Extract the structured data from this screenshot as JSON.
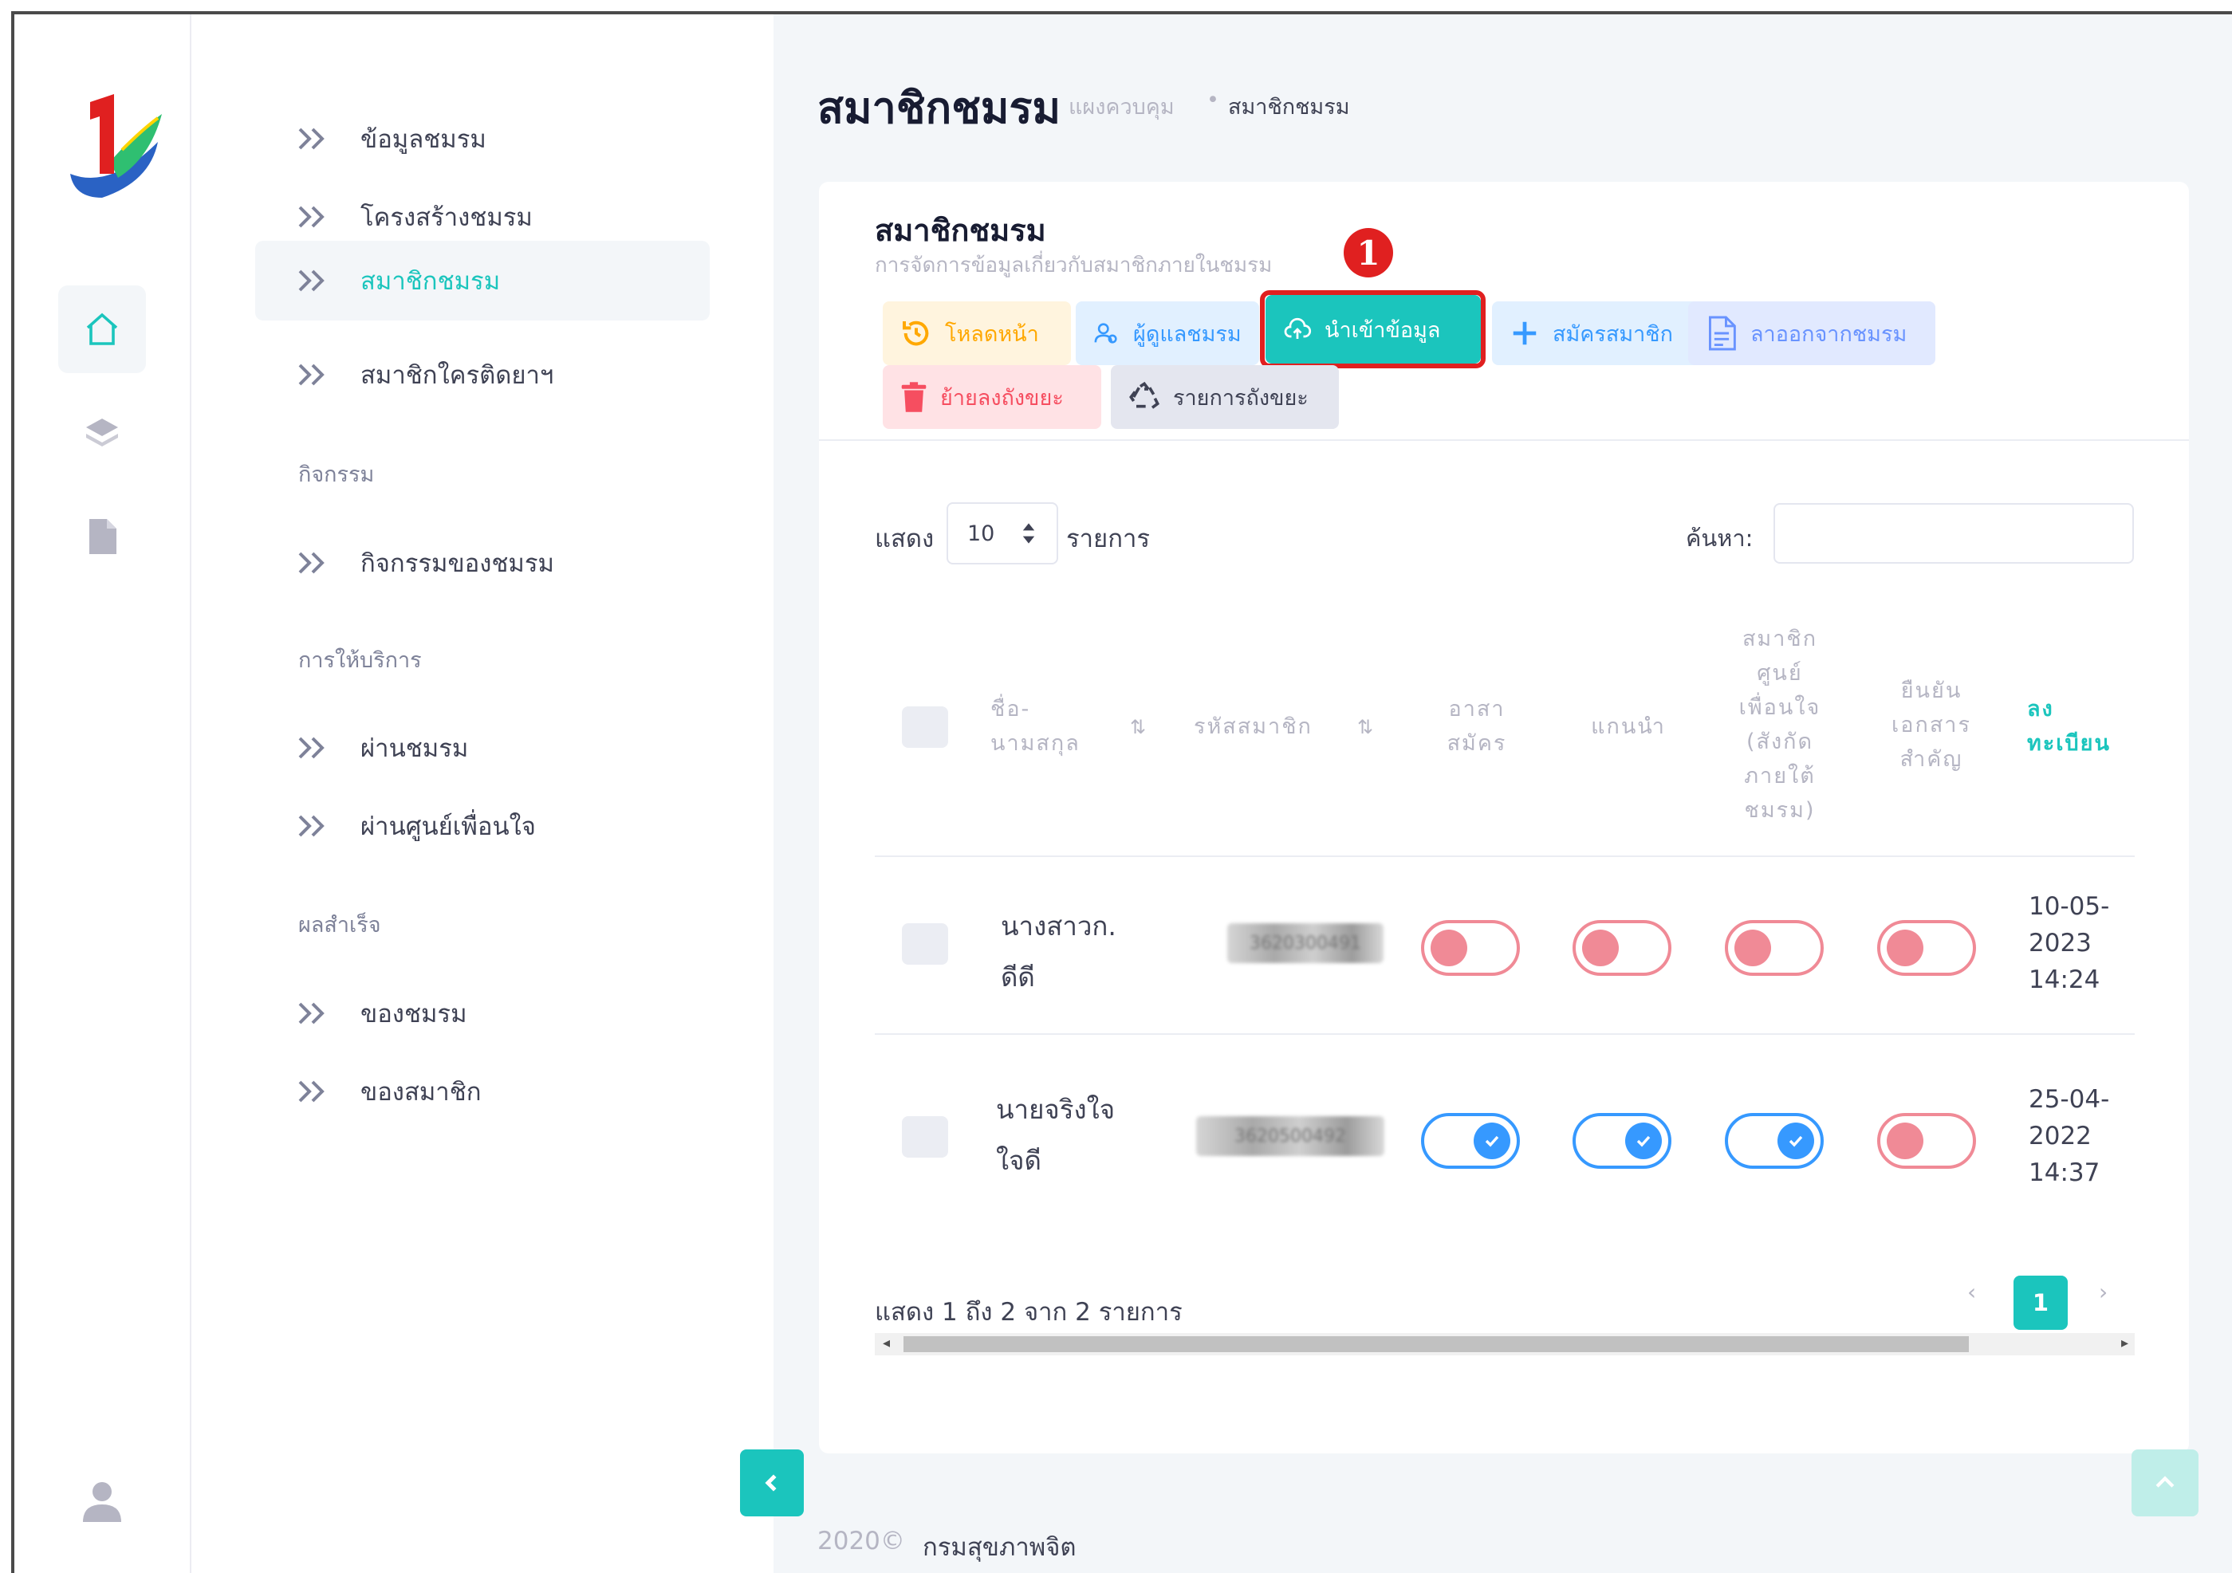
{
  "menu": {
    "items": [
      {
        "label": "ข้อมูลชมรม"
      },
      {
        "label": "โครงสร้างชมรม"
      },
      {
        "label": "สมาชิกชมรม"
      },
      {
        "label": "สมาชิกใครติดยาฯ"
      },
      {
        "label": "กิจกรรมของชมรม"
      },
      {
        "label": "ผ่านชมรม"
      },
      {
        "label": "ผ่านศูนย์เพื่อนใจ"
      },
      {
        "label": "ของชมรม"
      },
      {
        "label": "ของสมาชิก"
      }
    ],
    "sections": [
      "กิจกรรม",
      "การให้บริการ",
      "ผลสำเร็จ"
    ]
  },
  "header": {
    "title": "สมาชิกชมรม",
    "breadcrumb_home": "แผงควบคุม",
    "breadcrumb_sep": "•",
    "breadcrumb_current": "สมาชิกชมรม"
  },
  "card": {
    "title": "สมาชิกชมรม",
    "subtitle": "การจัดการข้อมูลเกี่ยวกับสมาชิกภายในชมรม",
    "marker": "1"
  },
  "toolbar": {
    "reload": "โหลดหน้า",
    "manager": "ผู้ดูแลชมรม",
    "import": "นำเข้าข้อมูล",
    "register": "สมัครสมาชิก",
    "resign": "ลาออกจากชมรม",
    "trash_move": "ย้ายลงถังขยะ",
    "trash_list": "รายการถังขยะ"
  },
  "table_controls": {
    "show_label": "แสดง",
    "page_size": "10",
    "show_suffix": "รายการ",
    "search_label": "ค้นหา:"
  },
  "table": {
    "headers": {
      "name": [
        "ชื่อ-",
        "นามสกุล"
      ],
      "member_id": "รหัสสมาชิก",
      "volunteer": [
        "อาสา",
        "สมัคร"
      ],
      "leader": "แกนนำ",
      "center_member": [
        "สมาชิก",
        "ศูนย์",
        "เพื่อนใจ",
        "(สังกัด",
        "ภายใต้",
        "ชมรม)"
      ],
      "docs": [
        "ยืนยัน",
        "เอกสาร",
        "สำคัญ"
      ],
      "registered": [
        "ลง",
        "ทะเบียน"
      ]
    },
    "sort_glyph": "⇅",
    "rows": [
      {
        "name": [
          "นางสาวก.",
          "ดีดี"
        ],
        "member_id": "3620300491",
        "volunteer": false,
        "leader": false,
        "center_member": false,
        "docs": false,
        "date": [
          "10-05-",
          "2023",
          "14:24"
        ]
      },
      {
        "name": [
          "นายจริงใจ",
          "ใจดี"
        ],
        "member_id": "3620500492",
        "volunteer": true,
        "leader": true,
        "center_member": true,
        "docs": false,
        "date": [
          "25-04-",
          "2022",
          "14:37"
        ]
      }
    ]
  },
  "pagination": {
    "info": "แสดง 1 ถึง 2 จาก 2 รายการ",
    "prev": "‹",
    "current": "1",
    "next": "›"
  },
  "footer": {
    "year": "2020©",
    "org": "กรมสุขภาพจิต"
  },
  "colors": {
    "accent": "#1bc5bd",
    "toggle_on": "#3699ff",
    "toggle_off": "#f08a96",
    "highlight": "#e02020"
  },
  "icons": [
    "home-icon",
    "layers-icon",
    "file-icon",
    "user-icon",
    "chevrons-right-icon",
    "history-icon",
    "users-icon",
    "cloud-upload-icon",
    "plus-icon",
    "document-icon",
    "trash-icon",
    "recycle-icon",
    "check-icon",
    "chevron-left-icon",
    "chevron-up-icon"
  ]
}
